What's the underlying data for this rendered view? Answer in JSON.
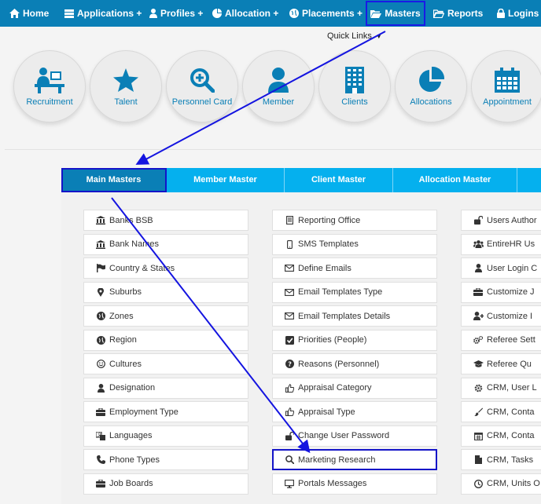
{
  "nav": {
    "home": "Home",
    "applications": "Applications +",
    "profiles": "Profiles +",
    "allocation": "Allocation +",
    "placements": "Placements +",
    "masters": "Masters",
    "reports": "Reports",
    "logins": "Logins"
  },
  "quick_links": {
    "label": "Quick Links",
    "items": [
      {
        "label": "Recruitment",
        "icon": "recruitment-icon"
      },
      {
        "label": "Talent",
        "icon": "star-icon"
      },
      {
        "label": "Personnel Card",
        "icon": "magnify-plus-icon"
      },
      {
        "label": "Member",
        "icon": "user-icon"
      },
      {
        "label": "Clients",
        "icon": "building-icon"
      },
      {
        "label": "Allocations",
        "icon": "pie-chart-icon"
      },
      {
        "label": "Appointment",
        "icon": "calendar-icon"
      }
    ]
  },
  "tabs": [
    "Main Masters",
    "Member Master",
    "Client Master",
    "Allocation Master"
  ],
  "columns": [
    [
      {
        "label": "Banks BSB",
        "icon": "bank-icon"
      },
      {
        "label": "Bank Names",
        "icon": "bank-icon"
      },
      {
        "label": "Country & States",
        "icon": "flag-icon"
      },
      {
        "label": "Suburbs",
        "icon": "map-marker-icon"
      },
      {
        "label": "Zones",
        "icon": "globe-icon"
      },
      {
        "label": "Region",
        "icon": "globe-icon"
      },
      {
        "label": "Cultures",
        "icon": "smile-icon"
      },
      {
        "label": "Designation",
        "icon": "user-icon"
      },
      {
        "label": "Employment Type",
        "icon": "briefcase-icon"
      },
      {
        "label": "Languages",
        "icon": "language-icon"
      },
      {
        "label": "Phone Types",
        "icon": "phone-icon"
      },
      {
        "label": "Job Boards",
        "icon": "briefcase-icon"
      }
    ],
    [
      {
        "label": "Reporting Office",
        "icon": "document-icon"
      },
      {
        "label": "SMS Templates",
        "icon": "mobile-icon"
      },
      {
        "label": "Define Emails",
        "icon": "envelope-icon"
      },
      {
        "label": "Email Templates Type",
        "icon": "envelope-icon"
      },
      {
        "label": "Email Templates Details",
        "icon": "envelope-icon"
      },
      {
        "label": "Priorities (People)",
        "icon": "check-square-icon"
      },
      {
        "label": "Reasons (Personnel)",
        "icon": "question-circle-icon"
      },
      {
        "label": "Appraisal Category",
        "icon": "thumbs-up-icon"
      },
      {
        "label": "Appraisal Type",
        "icon": "thumbs-up-icon"
      },
      {
        "label": "Change User Password",
        "icon": "unlock-icon"
      },
      {
        "label": "Marketing Research",
        "icon": "search-icon"
      },
      {
        "label": "Portals Messages",
        "icon": "monitor-icon"
      }
    ],
    [
      {
        "label": "Users Author",
        "icon": "unlock-icon"
      },
      {
        "label": "EntireHR Us",
        "icon": "users-icon"
      },
      {
        "label": "User Login C",
        "icon": "user-icon"
      },
      {
        "label": "Customize J",
        "icon": "briefcase-icon"
      },
      {
        "label": "Customize I",
        "icon": "user-plus-icon"
      },
      {
        "label": "Referee Sett",
        "icon": "gears-icon"
      },
      {
        "label": "Referee Qu",
        "icon": "graduation-cap-icon"
      },
      {
        "label": "CRM, User L",
        "icon": "gear-icon"
      },
      {
        "label": "CRM, Conta",
        "icon": "paint-brush-icon"
      },
      {
        "label": "CRM, Conta",
        "icon": "calendar-icon"
      },
      {
        "label": "CRM, Tasks",
        "icon": "file-icon"
      },
      {
        "label": "CRM, Units O",
        "icon": "clock-icon"
      }
    ]
  ],
  "colors": {
    "nav_bg": "#0a7fb6",
    "tab_bg": "#05b0ee",
    "tab_active_bg": "#0a7fb6",
    "highlight": "#1414c8"
  }
}
